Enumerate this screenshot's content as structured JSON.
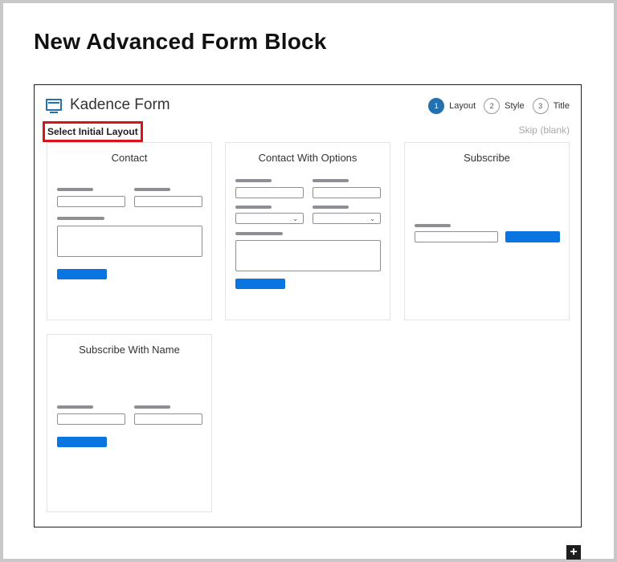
{
  "page": {
    "title": "New Advanced Form Block"
  },
  "block": {
    "icon": "form-icon",
    "title": "Kadence Form",
    "select_label": "Select Initial Layout",
    "skip_label": "Skip (blank)",
    "steps": [
      {
        "number": "1",
        "label": "Layout",
        "active": true
      },
      {
        "number": "2",
        "label": "Style",
        "active": false
      },
      {
        "number": "3",
        "label": "Title",
        "active": false
      }
    ]
  },
  "layouts": [
    {
      "title": "Contact"
    },
    {
      "title": "Contact With Options"
    },
    {
      "title": "Subscribe"
    },
    {
      "title": "Subscribe With Name"
    }
  ],
  "toolbar": {
    "add_icon": "plus-icon",
    "add_label": "+"
  },
  "colors": {
    "accent": "#2271b1",
    "button": "#0a75e0",
    "highlight": "#d6151b"
  }
}
